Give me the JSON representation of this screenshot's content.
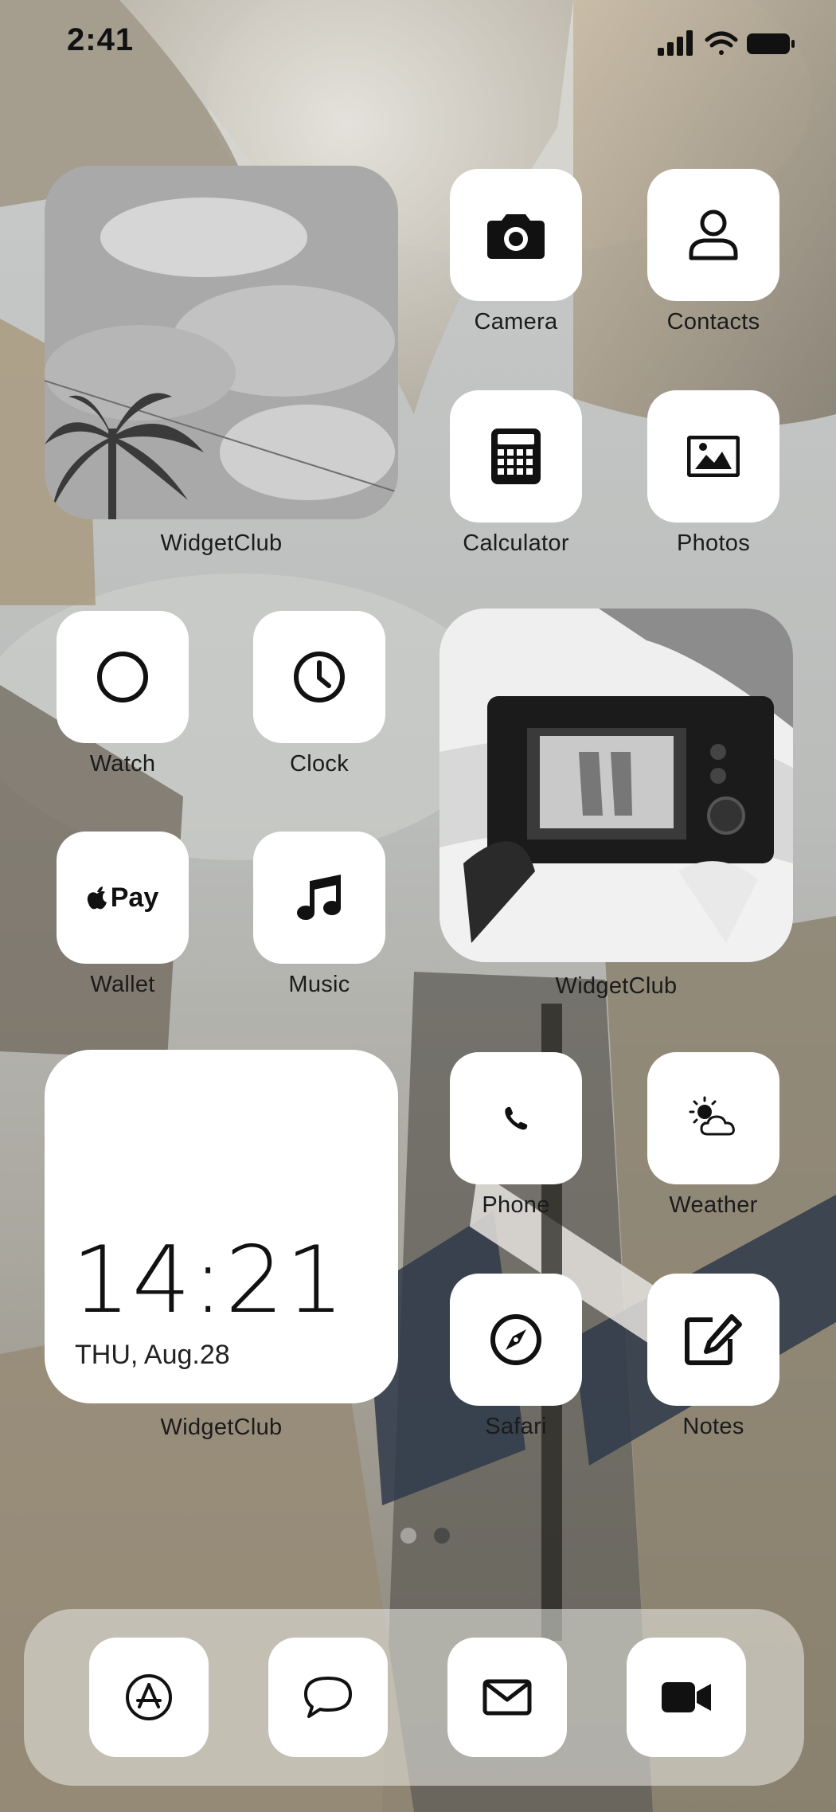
{
  "status_bar": {
    "time": "2:41",
    "signal_icon": "cellular-signal-icon",
    "wifi_icon": "wifi-icon",
    "battery_icon": "battery-icon"
  },
  "widgets": [
    {
      "id": "photo-widget-sky",
      "label": "WidgetClub"
    },
    {
      "id": "photo-widget-camera",
      "label": "WidgetClub"
    },
    {
      "id": "clock-widget",
      "label": "WidgetClub",
      "time": "14:21",
      "date": "THU, Aug.28"
    }
  ],
  "apps": {
    "camera": {
      "label": "Camera",
      "icon": "camera-icon"
    },
    "contacts": {
      "label": "Contacts",
      "icon": "person-icon"
    },
    "calculator": {
      "label": "Calculator",
      "icon": "calculator-icon"
    },
    "photos": {
      "label": "Photos",
      "icon": "photo-icon"
    },
    "watch": {
      "label": "Watch",
      "icon": "circle-icon"
    },
    "clock": {
      "label": "Clock",
      "icon": "clock-icon"
    },
    "wallet": {
      "label": "Wallet",
      "icon": "apple-pay-icon",
      "icon_text": "Pay"
    },
    "music": {
      "label": "Music",
      "icon": "music-note-icon"
    },
    "phone": {
      "label": "Phone",
      "icon": "phone-icon"
    },
    "weather": {
      "label": "Weather",
      "icon": "sun-cloud-icon"
    },
    "safari": {
      "label": "Safari",
      "icon": "compass-icon"
    },
    "notes": {
      "label": "Notes",
      "icon": "pencil-square-icon"
    }
  },
  "dock": [
    {
      "icon": "app-store-icon"
    },
    {
      "icon": "speech-bubble-icon"
    },
    {
      "icon": "envelope-icon"
    },
    {
      "icon": "video-camera-icon"
    }
  ],
  "page_indicator": {
    "pages": 2,
    "current": 2
  },
  "colors": {
    "tile": "#ffffff",
    "label": "#1b1b1b",
    "dot_active": "#4a4a48",
    "dot_inactive": "#a3a39e"
  }
}
